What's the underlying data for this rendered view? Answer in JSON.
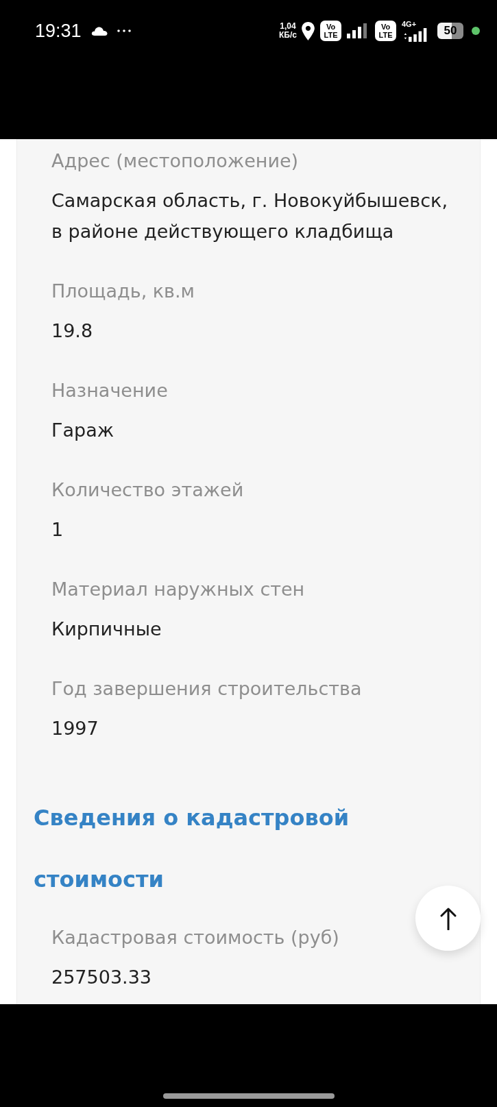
{
  "status_bar": {
    "time": "19:31",
    "network_speed": {
      "value": "1,04",
      "unit": "КБ/с"
    },
    "sim_badges": [
      "Vo LTE",
      "Vo LTE"
    ],
    "network_type": "4G+",
    "battery": "50"
  },
  "fields": [
    {
      "label": "Адрес (местоположение)",
      "value": "Самарская область, г. Новокуйбышевск, в районе действующего кладбища"
    },
    {
      "label": "Площадь, кв.м",
      "value": "19.8"
    },
    {
      "label": "Назначение",
      "value": "Гараж"
    },
    {
      "label": "Количество этажей",
      "value": "1"
    },
    {
      "label": "Материал наружных стен",
      "value": "Кирпичные"
    },
    {
      "label": "Год завершения строительства",
      "value": "1997"
    }
  ],
  "cadastral_section": {
    "heading": "Сведения о кадастровой стоимости",
    "fields": [
      {
        "label": "Кадастровая стоимость (руб)",
        "value": "257503.33"
      }
    ]
  }
}
